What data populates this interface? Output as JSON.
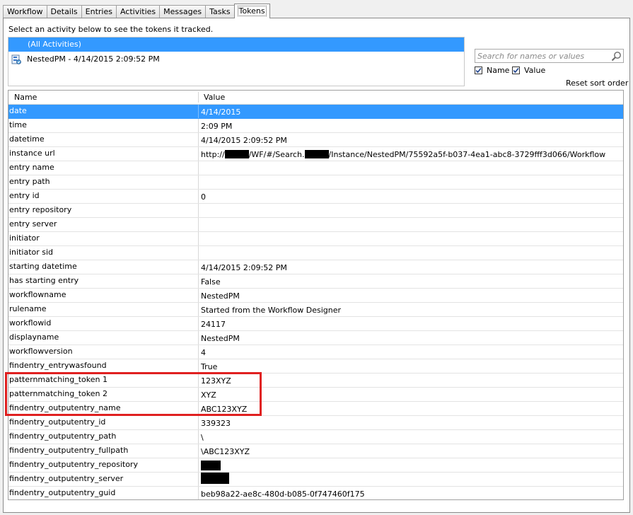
{
  "tabs": [
    {
      "label": "Workflow",
      "active": false
    },
    {
      "label": "Details",
      "active": false
    },
    {
      "label": "Entries",
      "active": false
    },
    {
      "label": "Activities",
      "active": false
    },
    {
      "label": "Messages",
      "active": false
    },
    {
      "label": "Tasks",
      "active": false
    },
    {
      "label": "Tokens",
      "active": true
    }
  ],
  "instruction": "Select an activity below to see the tokens it tracked.",
  "activities": {
    "all": "(All Activities)",
    "item": "NestedPM - 4/14/2015 2:09:52 PM"
  },
  "search": {
    "placeholder": "Search for names or values"
  },
  "filters": {
    "name_label": "Name",
    "value_label": "Value",
    "reset_label": "Reset sort order"
  },
  "grid": {
    "col_name": "Name",
    "col_value": "Value",
    "rows": [
      {
        "name": "date",
        "value": "4/14/2015"
      },
      {
        "name": "time",
        "value": "2:09 PM"
      },
      {
        "name": "datetime",
        "value": "4/14/2015 2:09:52 PM"
      },
      {
        "name": "instance url",
        "value_parts": [
          "http://",
          "/WF/#/Search.",
          "/Instance/NestedPM/75592a5f-b037-4ea1-abc8-3729fff3d066/Workflow"
        ]
      },
      {
        "name": "entry name",
        "value": ""
      },
      {
        "name": "entry path",
        "value": ""
      },
      {
        "name": "entry id",
        "value": "0"
      },
      {
        "name": "entry repository",
        "value": ""
      },
      {
        "name": "entry server",
        "value": ""
      },
      {
        "name": "initiator",
        "value": ""
      },
      {
        "name": "initiator sid",
        "value": ""
      },
      {
        "name": "starting datetime",
        "value": "4/14/2015 2:09:52 PM"
      },
      {
        "name": "has starting entry",
        "value": "False"
      },
      {
        "name": "workflowname",
        "value": "NestedPM"
      },
      {
        "name": "rulename",
        "value": "Started from the Workflow Designer"
      },
      {
        "name": "workflowid",
        "value": "24117"
      },
      {
        "name": "displayname",
        "value": "NestedPM"
      },
      {
        "name": "workflowversion",
        "value": "4"
      },
      {
        "name": "findentry_entrywasfound",
        "value": "True"
      },
      {
        "name": "patternmatching_token 1",
        "value": "123XYZ"
      },
      {
        "name": "patternmatching_token 2",
        "value": "XYZ"
      },
      {
        "name": "findentry_outputentry_name",
        "value": "ABC123XYZ"
      },
      {
        "name": "findentry_outputentry_id",
        "value": "339323"
      },
      {
        "name": "findentry_outputentry_path",
        "value": "\\"
      },
      {
        "name": "findentry_outputentry_fullpath",
        "value": "\\ABC123XYZ"
      },
      {
        "name": "findentry_outputentry_repository",
        "value": ""
      },
      {
        "name": "findentry_outputentry_server",
        "value": ""
      },
      {
        "name": "findentry_outputentry_guid",
        "value": "beb98a22-ae8c-480d-b085-0f747460f175"
      }
    ]
  },
  "colors": {
    "selection": "#3399ff",
    "highlight": "#e02020"
  }
}
